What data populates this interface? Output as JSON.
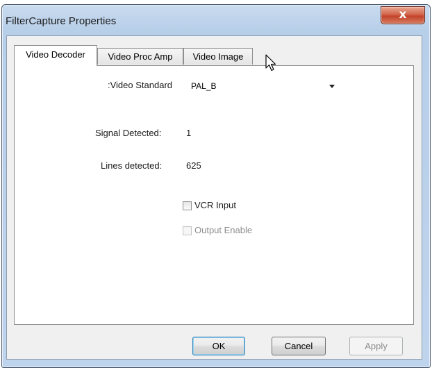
{
  "window": {
    "title": "FilterCapture Properties",
    "close_glyph": "x"
  },
  "tabs": [
    {
      "label": "Video Decoder",
      "active": true
    },
    {
      "label": "Video Proc Amp",
      "active": false
    },
    {
      "label": "Video Image",
      "active": false
    }
  ],
  "video_decoder": {
    "video_standard_label": ":Video Standard",
    "video_standard_value": "PAL_B",
    "signal_detected_label": "Signal Detected:",
    "signal_detected_value": "1",
    "lines_detected_label": "Lines detected:",
    "lines_detected_value": "625",
    "vcr_input_label": "VCR Input",
    "vcr_input_checked": false,
    "output_enable_label": "Output Enable",
    "output_enable_enabled": false
  },
  "buttons": {
    "ok": "OK",
    "cancel": "Cancel",
    "apply": "Apply"
  },
  "colors": {
    "frame": "#b8cfe9",
    "close": "#c3422a",
    "default_button": "#3c7fb1"
  },
  "icons": {
    "cursor": "mouse-pointer-icon"
  }
}
